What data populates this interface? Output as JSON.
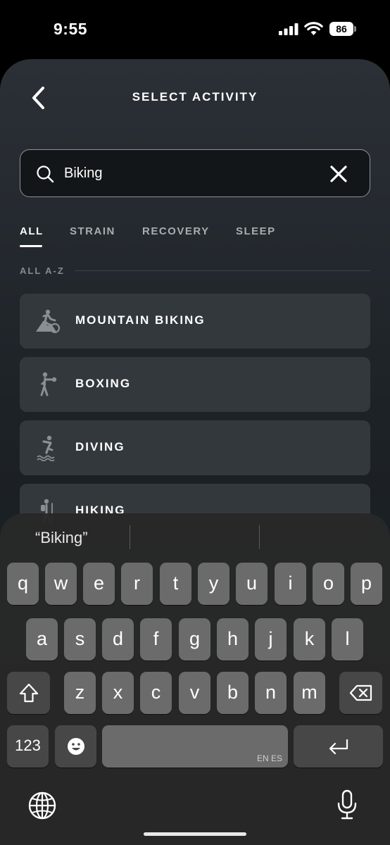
{
  "status": {
    "time": "9:55",
    "battery": "86"
  },
  "header": {
    "title": "SELECT ACTIVITY"
  },
  "search": {
    "value": "Biking"
  },
  "tabs": [
    {
      "label": "ALL",
      "active": true
    },
    {
      "label": "STRAIN"
    },
    {
      "label": "RECOVERY"
    },
    {
      "label": "SLEEP"
    }
  ],
  "section": {
    "label": "ALL A-Z"
  },
  "activities": [
    {
      "label": "MOUNTAIN BIKING",
      "icon": "mountain-biking-icon"
    },
    {
      "label": "BOXING",
      "icon": "boxing-icon"
    },
    {
      "label": "DIVING",
      "icon": "diving-icon"
    },
    {
      "label": "HIKING",
      "icon": "hiking-icon"
    }
  ],
  "keyboard": {
    "suggestion": "“Biking”",
    "row1": [
      "q",
      "w",
      "e",
      "r",
      "t",
      "y",
      "u",
      "i",
      "o",
      "p"
    ],
    "row2": [
      "a",
      "s",
      "d",
      "f",
      "g",
      "h",
      "j",
      "k",
      "l"
    ],
    "row3": [
      "z",
      "x",
      "c",
      "v",
      "b",
      "n",
      "m"
    ],
    "numbers_key": "123",
    "space_lang": "EN ES"
  },
  "colors": {
    "sheet_top": "#2b3036",
    "card": "#33383d",
    "accent": "#ffffff",
    "keyboard": "#282828"
  }
}
